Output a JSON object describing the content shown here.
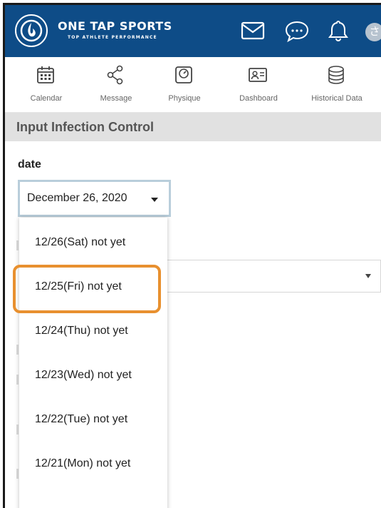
{
  "header": {
    "brand_title": "ONE TAP SPORTS",
    "brand_subtitle": "TOP ATHLETE PERFORMANCE",
    "avatar_initial": "さ",
    "icons": [
      "mail-icon",
      "chat-icon",
      "bell-icon"
    ]
  },
  "nav": {
    "items": [
      {
        "label": "Calendar",
        "icon": "calendar-icon"
      },
      {
        "label": "Message",
        "icon": "share-icon"
      },
      {
        "label": "Physique",
        "icon": "scale-icon"
      },
      {
        "label": "Dashboard",
        "icon": "id-card-icon"
      },
      {
        "label": "Historical Data",
        "icon": "database-icon"
      }
    ]
  },
  "section": {
    "title": "Input Infection Control"
  },
  "form": {
    "date_label": "date",
    "date_selected": "December 26, 2020"
  },
  "dropdown": {
    "options": [
      "12/26(Sat) not yet",
      "12/25(Fri) not yet",
      "12/24(Thu) not yet",
      "12/23(Wed) not yet",
      "12/22(Tue) not yet",
      "12/21(Mon) not yet"
    ],
    "highlighted_index": 1
  },
  "colors": {
    "header_bg": "#0e4c87",
    "highlight": "#e8902f",
    "select_border": "#b9cedb",
    "section_bg": "#e1e1e1"
  }
}
